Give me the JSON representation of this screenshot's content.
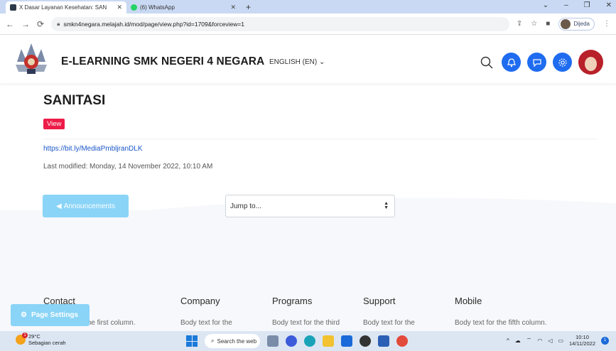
{
  "browser": {
    "tabs": [
      {
        "title": "X Dasar Layanan Kesehatan: SAN",
        "active": true,
        "favicon_color": "#2d3a4a"
      },
      {
        "title": "(6) WhatsApp",
        "active": false,
        "favicon_color": "#25d366"
      }
    ],
    "new_tab_icon": "+",
    "url": "smkn4negara.melajah.id/mod/page/view.php?id=1709&forceview=1",
    "profile_label": "Dijeda"
  },
  "site": {
    "name": "E-LEARNING SMK NEGERI 4 NEGARA",
    "language": "ENGLISH (EN)",
    "accent_color": "#1f6cf0"
  },
  "page": {
    "title": "SANITASI",
    "badge": "View",
    "link_text": "https://bit.ly/MediaPmbljranDLK",
    "last_modified": "Last modified: Monday, 14 November 2022, 10:10 AM",
    "prev_button": "Announcements",
    "jump_placeholder": "Jump to..."
  },
  "footer": {
    "columns": [
      {
        "heading": "Contact",
        "body": "Body text for the first column."
      },
      {
        "heading": "Company",
        "body": "Body text for the"
      },
      {
        "heading": "Programs",
        "body": "Body text for the third"
      },
      {
        "heading": "Support",
        "body": "Body text for the"
      },
      {
        "heading": "Mobile",
        "body": "Body text for the fifth column."
      }
    ],
    "page_settings": "Page Settings"
  },
  "taskbar": {
    "temperature": "29°C",
    "weather": "Sebagian cerah",
    "weather_alert": "1",
    "search_label": "Search the web",
    "time": "10:10",
    "date": "14/11/2022",
    "notification_count": "1"
  }
}
